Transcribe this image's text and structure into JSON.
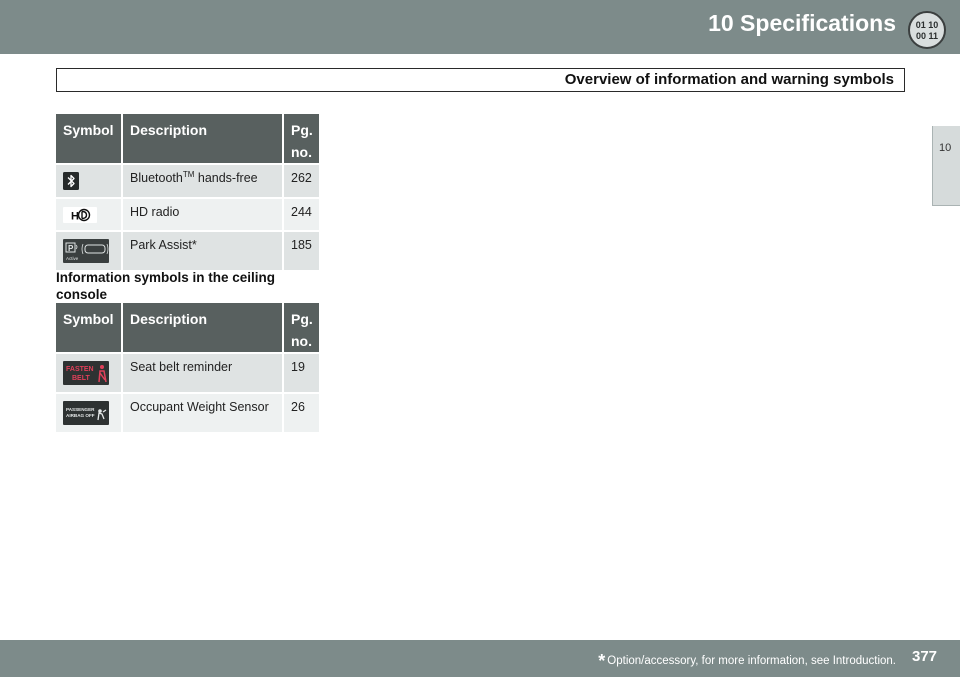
{
  "header": {
    "chapter": "10  Specifications",
    "icon": "speedometer-digits-icon",
    "icon_digits_top": "01 10",
    "icon_digits_bottom": "00 11"
  },
  "section": {
    "title": "Overview of information and warning symbols"
  },
  "side_tab": {
    "label": "10"
  },
  "table_headers": {
    "symbol": "Symbol",
    "description": "Description",
    "page_line1": "Pg.",
    "page_line2": "no."
  },
  "table1": {
    "rows": [
      {
        "icon": "bluetooth-icon",
        "description_main": "Bluetooth",
        "description_sup": "TM",
        "description_rest": " hands-free",
        "page": "262"
      },
      {
        "icon": "hd-radio-icon",
        "description": "HD radio",
        "page": "244"
      },
      {
        "icon": "park-assist-icon",
        "icon_text": "Active",
        "description": "Park Assist*",
        "page": "185"
      }
    ]
  },
  "subheading": "Information symbols in the ceiling console",
  "table2": {
    "rows": [
      {
        "icon": "fasten-belt-icon",
        "icon_text_1": "FASTEN",
        "icon_text_2": "BELT",
        "description": "Seat belt reminder",
        "page": "19"
      },
      {
        "icon": "passenger-airbag-off-icon",
        "icon_text_1": "PASSENGER",
        "icon_text_2": "AIRBAG  OFF",
        "description": "Occupant Weight Sensor",
        "page": "26"
      }
    ]
  },
  "footer": {
    "star": "*",
    "footnote": "Option/accessory, for more information, see Introduction.",
    "page_number": "377"
  }
}
